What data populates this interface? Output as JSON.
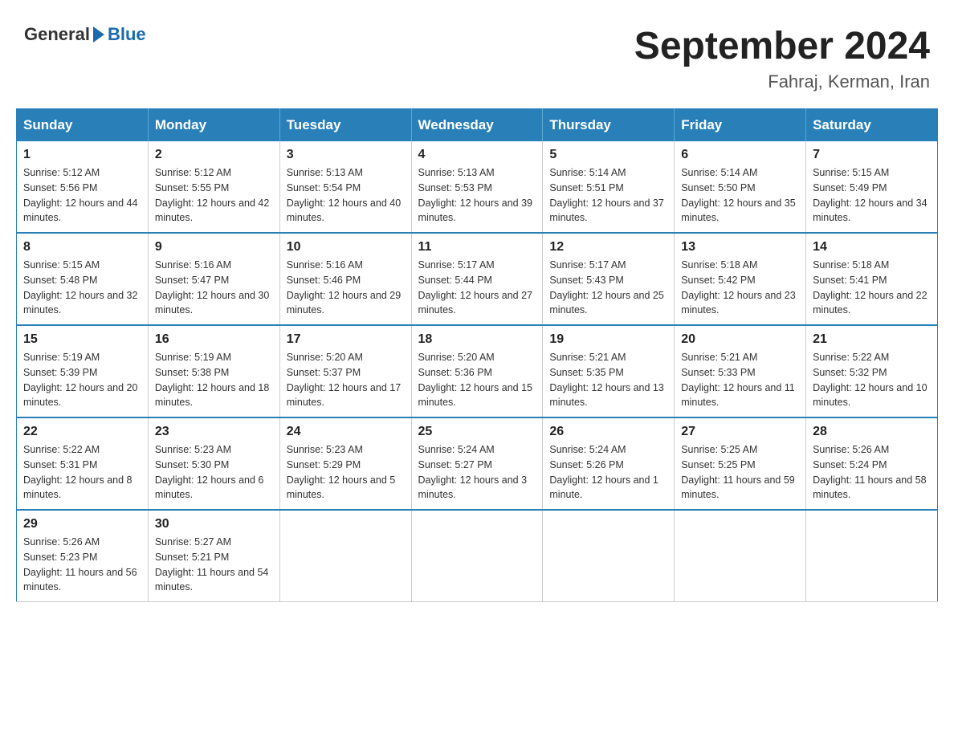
{
  "logo": {
    "general": "General",
    "blue": "Blue"
  },
  "title": "September 2024",
  "subtitle": "Fahraj, Kerman, Iran",
  "headers": [
    "Sunday",
    "Monday",
    "Tuesday",
    "Wednesday",
    "Thursday",
    "Friday",
    "Saturday"
  ],
  "weeks": [
    [
      {
        "day": "1",
        "sunrise": "5:12 AM",
        "sunset": "5:56 PM",
        "daylight": "12 hours and 44 minutes."
      },
      {
        "day": "2",
        "sunrise": "5:12 AM",
        "sunset": "5:55 PM",
        "daylight": "12 hours and 42 minutes."
      },
      {
        "day": "3",
        "sunrise": "5:13 AM",
        "sunset": "5:54 PM",
        "daylight": "12 hours and 40 minutes."
      },
      {
        "day": "4",
        "sunrise": "5:13 AM",
        "sunset": "5:53 PM",
        "daylight": "12 hours and 39 minutes."
      },
      {
        "day": "5",
        "sunrise": "5:14 AM",
        "sunset": "5:51 PM",
        "daylight": "12 hours and 37 minutes."
      },
      {
        "day": "6",
        "sunrise": "5:14 AM",
        "sunset": "5:50 PM",
        "daylight": "12 hours and 35 minutes."
      },
      {
        "day": "7",
        "sunrise": "5:15 AM",
        "sunset": "5:49 PM",
        "daylight": "12 hours and 34 minutes."
      }
    ],
    [
      {
        "day": "8",
        "sunrise": "5:15 AM",
        "sunset": "5:48 PM",
        "daylight": "12 hours and 32 minutes."
      },
      {
        "day": "9",
        "sunrise": "5:16 AM",
        "sunset": "5:47 PM",
        "daylight": "12 hours and 30 minutes."
      },
      {
        "day": "10",
        "sunrise": "5:16 AM",
        "sunset": "5:46 PM",
        "daylight": "12 hours and 29 minutes."
      },
      {
        "day": "11",
        "sunrise": "5:17 AM",
        "sunset": "5:44 PM",
        "daylight": "12 hours and 27 minutes."
      },
      {
        "day": "12",
        "sunrise": "5:17 AM",
        "sunset": "5:43 PM",
        "daylight": "12 hours and 25 minutes."
      },
      {
        "day": "13",
        "sunrise": "5:18 AM",
        "sunset": "5:42 PM",
        "daylight": "12 hours and 23 minutes."
      },
      {
        "day": "14",
        "sunrise": "5:18 AM",
        "sunset": "5:41 PM",
        "daylight": "12 hours and 22 minutes."
      }
    ],
    [
      {
        "day": "15",
        "sunrise": "5:19 AM",
        "sunset": "5:39 PM",
        "daylight": "12 hours and 20 minutes."
      },
      {
        "day": "16",
        "sunrise": "5:19 AM",
        "sunset": "5:38 PM",
        "daylight": "12 hours and 18 minutes."
      },
      {
        "day": "17",
        "sunrise": "5:20 AM",
        "sunset": "5:37 PM",
        "daylight": "12 hours and 17 minutes."
      },
      {
        "day": "18",
        "sunrise": "5:20 AM",
        "sunset": "5:36 PM",
        "daylight": "12 hours and 15 minutes."
      },
      {
        "day": "19",
        "sunrise": "5:21 AM",
        "sunset": "5:35 PM",
        "daylight": "12 hours and 13 minutes."
      },
      {
        "day": "20",
        "sunrise": "5:21 AM",
        "sunset": "5:33 PM",
        "daylight": "12 hours and 11 minutes."
      },
      {
        "day": "21",
        "sunrise": "5:22 AM",
        "sunset": "5:32 PM",
        "daylight": "12 hours and 10 minutes."
      }
    ],
    [
      {
        "day": "22",
        "sunrise": "5:22 AM",
        "sunset": "5:31 PM",
        "daylight": "12 hours and 8 minutes."
      },
      {
        "day": "23",
        "sunrise": "5:23 AM",
        "sunset": "5:30 PM",
        "daylight": "12 hours and 6 minutes."
      },
      {
        "day": "24",
        "sunrise": "5:23 AM",
        "sunset": "5:29 PM",
        "daylight": "12 hours and 5 minutes."
      },
      {
        "day": "25",
        "sunrise": "5:24 AM",
        "sunset": "5:27 PM",
        "daylight": "12 hours and 3 minutes."
      },
      {
        "day": "26",
        "sunrise": "5:24 AM",
        "sunset": "5:26 PM",
        "daylight": "12 hours and 1 minute."
      },
      {
        "day": "27",
        "sunrise": "5:25 AM",
        "sunset": "5:25 PM",
        "daylight": "11 hours and 59 minutes."
      },
      {
        "day": "28",
        "sunrise": "5:26 AM",
        "sunset": "5:24 PM",
        "daylight": "11 hours and 58 minutes."
      }
    ],
    [
      {
        "day": "29",
        "sunrise": "5:26 AM",
        "sunset": "5:23 PM",
        "daylight": "11 hours and 56 minutes."
      },
      {
        "day": "30",
        "sunrise": "5:27 AM",
        "sunset": "5:21 PM",
        "daylight": "11 hours and 54 minutes."
      },
      null,
      null,
      null,
      null,
      null
    ]
  ],
  "labels": {
    "sunrise_prefix": "Sunrise: ",
    "sunset_prefix": "Sunset: ",
    "daylight_prefix": "Daylight: "
  }
}
